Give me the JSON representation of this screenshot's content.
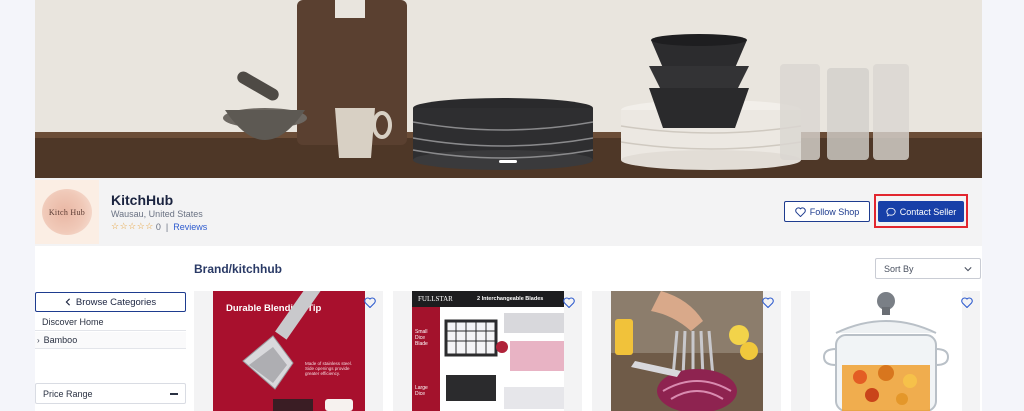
{
  "shop": {
    "logo_text": "Kitch Hub",
    "name": "KitchHub",
    "location": "Wausau, United States",
    "rating_stars": "☆☆☆☆☆",
    "rating_count": "0",
    "separator": "|",
    "reviews_label": "Reviews",
    "follow_label": "Follow Shop",
    "contact_label": "Contact Seller"
  },
  "catalog": {
    "title": "Brand/kitchhub",
    "sort_label": "Sort By"
  },
  "sidebar": {
    "browse_label": "Browse Categories",
    "categories": [
      {
        "label": "Discover Home"
      },
      {
        "label": "Bamboo"
      }
    ],
    "price_range_label": "Price Range"
  },
  "products": [
    {
      "image_text": "Durable Blending Tip",
      "image_subtext": "Made of stainless steel. Side openings provide greater efficiency."
    },
    {
      "image_brand": "FULLSTAR",
      "image_label": "2 Interchangeable Blades",
      "image_side_1": "Small Dice Blade",
      "image_side_2": "Large Dice"
    },
    {},
    {}
  ],
  "colors": {
    "accent_blue": "#1840a8",
    "highlight_red": "#e2262f",
    "star": "#e6a23c"
  }
}
